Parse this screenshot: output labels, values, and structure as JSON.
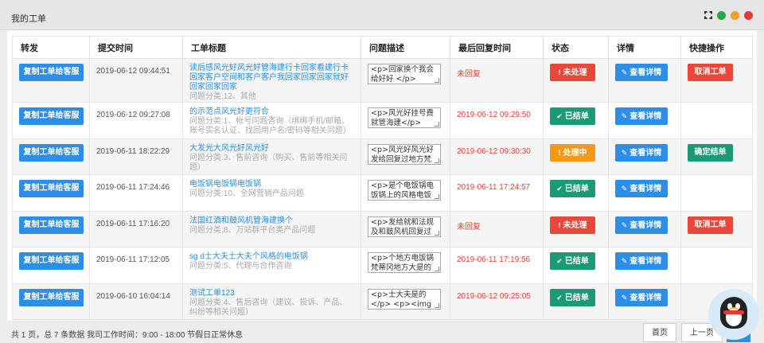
{
  "panel": {
    "title": "我的工单"
  },
  "columns": [
    "转发",
    "提交时间",
    "工单标题",
    "问题描述",
    "最后回复时间",
    "状态",
    "详情",
    "快捷操作"
  ],
  "copy_label": "复制工单给客服",
  "detail_label": "查看详情",
  "rows": [
    {
      "time": "2019-06-12 09:44:51",
      "title": "读后感风光好风光好管海建行卡回家看建行卡回家客户空间和客户客户我回家回家回家就好回家回家回家",
      "category": "问题分类:12、其他",
      "desc": "<p>回家换个我会给好好 </p>",
      "reply": "未回复",
      "status": "未处理",
      "status_type": "red",
      "action": "取消工单",
      "action_type": "red"
    },
    {
      "time": "2019-06-12 09:27:08",
      "title": "的示范点风光好更符合",
      "category": "问题分类:1、帐号问题咨询（绑绑手机/邮箱、账号实名认证、找回用户名/密码等相关问题）",
      "desc": "<p>风光好挂号费就管海建</p>",
      "reply": "2019-06-12 09:29:50",
      "status": "已结单",
      "status_type": "green",
      "action": "",
      "action_type": ""
    },
    {
      "time": "2019-06-11 18:22:29",
      "title": "大发光大风光好风光好",
      "category": "问题分类:3、售前咨询（购买、售前等相关问题）",
      "desc": "<p>风光好风光好发给回复过地方梵蒂冈",
      "reply": "2019-06-12 09:30:30",
      "status": "处理中",
      "status_type": "orange",
      "action": "确定结单",
      "action_type": "green"
    },
    {
      "time": "2019-06-11 17:24:46",
      "title": "电饭锅电饭锅电饭锅",
      "category": "问题分类:10、全网营销产品问题",
      "desc": "<p>是个电饭锅电饭锅上的风格电饭锅电",
      "reply": "2019-06-11 17:24:57",
      "status": "已结单",
      "status_type": "green",
      "action": "",
      "action_type": ""
    },
    {
      "time": "2019-06-11 17:16:20",
      "title": "法国红酒和鼓风机管海建换个",
      "category": "问题分类:8、万站群平台类产品问题",
      "desc": "<p>发给就和法规及和鼓风机回复过回复",
      "reply": "未回复",
      "status": "未处理",
      "status_type": "red",
      "action": "取消工单",
      "action_type": "red"
    },
    {
      "time": "2019-06-11 17:12:05",
      "title": "sg d士大夫士大夫个风格的电饭锅",
      "category": "问题分类:5、代理与合作咨询",
      "desc": "<p>个地方电饭锅梵蒂冈地方大是的发沙",
      "reply": "2019-06-11 17:19:56",
      "status": "已结单",
      "status_type": "green",
      "action": "",
      "action_type": ""
    },
    {
      "time": "2019-06-10 16:04:14",
      "title": "测试工单123",
      "category": "问题分类:4、售后咨询（建议、投诉、产品、纠纷等相关问题）",
      "desc": "<p>士大夫是的</p> <p><img",
      "reply": "2019-06-12 09:25:05",
      "status": "已结单",
      "status_type": "green",
      "action": "",
      "action_type": ""
    }
  ],
  "footer": {
    "summary": "共 1 页，总 7 条数据 我司工作时间：9:00 - 18:00 节假日正常休息",
    "first": "首页",
    "prev": "上一页",
    "current": "1"
  },
  "colors": {
    "blue": "#2d8ee8",
    "red": "#e8473a",
    "green": "#1a9b76",
    "orange": "#f29a18"
  }
}
